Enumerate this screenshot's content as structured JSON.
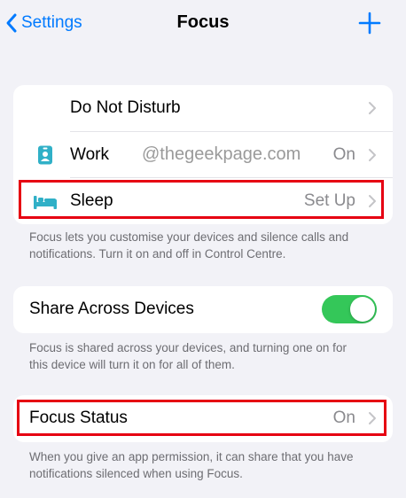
{
  "nav": {
    "back_label": "Settings",
    "title": "Focus"
  },
  "focus_modes": [
    {
      "label": "Do Not Disturb",
      "value": "",
      "icon": "moon-icon",
      "color": "#5e5ce6"
    },
    {
      "label": "Work",
      "value": "On",
      "icon": "id-badge-icon",
      "color": "#30b0c7"
    },
    {
      "label": "Sleep",
      "value": "Set Up",
      "icon": "bed-icon",
      "color": "#30b0c7"
    }
  ],
  "watermark": "@thegeekpage.com",
  "focus_modes_footer": "Focus lets you customise your devices and silence calls and notifications. Turn it on and off in Control Centre.",
  "share": {
    "label": "Share Across Devices",
    "enabled": true
  },
  "share_footer": "Focus is shared across your devices, and turning one on for this device will turn it on for all of them.",
  "focus_status": {
    "label": "Focus Status",
    "value": "On"
  },
  "focus_status_footer": "When you give an app permission, it can share that you have notifications silenced when using Focus.",
  "colors": {
    "accent": "#007aff",
    "toggle_on": "#34c759",
    "highlight": "#e60012"
  }
}
